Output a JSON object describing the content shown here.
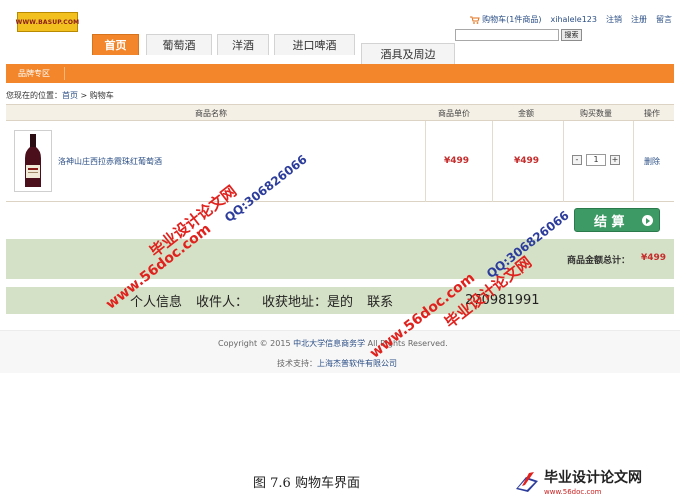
{
  "logo_text": "WWW.BASUP.COM",
  "nav": {
    "tabs": [
      "首页",
      "葡萄酒",
      "洋酒",
      "进口啤酒",
      "酒具及周边"
    ]
  },
  "toplinks": {
    "cart": "购物车(1件商品)",
    "user": "xihalele123",
    "logout": "注销",
    "register": "注册",
    "message": "留言"
  },
  "search": {
    "value": "",
    "button": "搜索"
  },
  "brand_zone": "品牌专区",
  "breadcrumb": {
    "prefix": "您现在的位置：",
    "home": "首页",
    "sep": " > ",
    "current": "购物车"
  },
  "table": {
    "headers": [
      "商品名称",
      "商品单价",
      "金额",
      "购买数量",
      "操作"
    ],
    "rows": [
      {
        "name": "洛神山庄西拉赤霞珠红葡萄酒",
        "unit_price": "¥499",
        "amount": "¥499",
        "qty": "1",
        "minus": "-",
        "plus": "+",
        "action": "删除"
      }
    ]
  },
  "checkout_label": "结 算",
  "total": {
    "label": "商品金额总计：",
    "amount": "¥499"
  },
  "info": {
    "personal": "个人信息",
    "receiver": "收件人：",
    "address": "收获地址：",
    "address_value": "是的",
    "contact": "联系",
    "phone_partial": "270981991"
  },
  "footer": {
    "copyright_prefix": "Copyright © 2015 ",
    "company": "中北大学信息商务学",
    "copyright_suffix": " All Rights Reserved.",
    "support_prefix": "技术支持：",
    "support": "上海杰普软件有限公司"
  },
  "watermarks": {
    "title": "毕业设计论文网",
    "url": "www.56doc.com",
    "qq": "QQ:306826066"
  },
  "caption": "图 7.6 购物车界面",
  "corner_logo": {
    "title": "毕业设计论文网",
    "url": "www.56doc.com"
  },
  "colors": {
    "accent_orange": "#f3862a",
    "price_red": "#c62c2c",
    "link_blue": "#2b4f86",
    "panel_green": "#d5e1c6",
    "button_green": "#3d9a64",
    "watermark_red": "#e0221e",
    "watermark_blue": "#2c3c9c"
  }
}
